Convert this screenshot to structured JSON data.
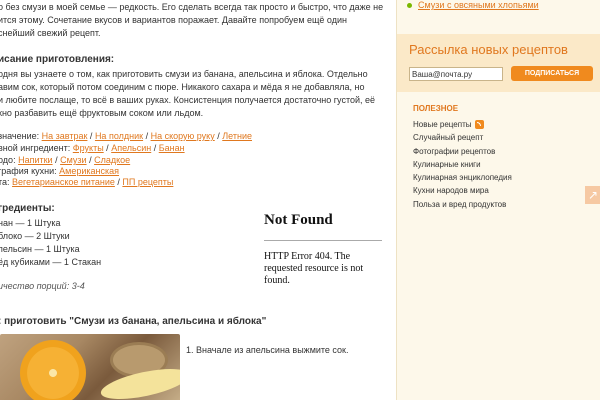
{
  "intro": {
    "line1": "о без смузи в моей семье — редкость. Его сделать всегда так просто и быстро, что даже не",
    "line2": "ится этому. Сочетание вкусов и вариантов поражает. Давайте попробуем ещё один",
    "line3": "снейший свежий рецепт."
  },
  "description": {
    "heading": "исание приготовления:",
    "line1": "одня вы узнаете о том, как приготовить смузи из банана, апельсина и яблока. Отдельно",
    "line2": "авим сок, который потом соединим с пюре. Никакого сахара и мёда я не добавляла, но",
    "line3": "и любите послаще, то всё в ваших руках. Консистенция получается достаточно густой, её",
    "line4": "кно разбавить ещё фруктовым соком или льдом."
  },
  "meta": {
    "purpose_label": "значение:",
    "purpose_links": [
      "На завтрак",
      "На полдник",
      "На скорую руку",
      "Летние"
    ],
    "ingredient_label": "вной ингредиент:",
    "ingredient_links": [
      "Фрукты",
      "Апельсин",
      "Банан"
    ],
    "dish_label": "одо:",
    "dish_links": [
      "Напитки",
      "Смузи",
      "Сладкое"
    ],
    "geo_label": "графия кухни:",
    "geo_links": [
      "Американская"
    ],
    "diet_label": "та:",
    "diet_links": [
      "Вегетарианское питание",
      "ПП рецепты"
    ],
    "separator": " / "
  },
  "ingredients": {
    "heading": "гредиенты:",
    "items": [
      "нан — 1 Штука",
      "блоко — 2 Штуки",
      "пельсин — 1 Штука",
      "ёд кубиками — 1 Стакан"
    ],
    "servings": "ичество порций: 3-4"
  },
  "howto": {
    "heading": ": приготовить \"Смузи из банана, апельсина и яблока\"",
    "step1": "1. Вначале из апельсина выжмите сок."
  },
  "error": {
    "title": "Not Found",
    "message": "HTTP Error 404. The requested resource is not found."
  },
  "sidebar": {
    "prev_link": "Смузи с овсяными хлопьями",
    "newsletter_title": "Рассылка новых рецептов",
    "email_value": "Ваша@почта.ру",
    "subscribe_label": "ПОДПИСАТЬСЯ",
    "useful_heading": "ПОЛЕЗНОЕ",
    "links": [
      "Новые рецепты",
      "Случайный рецепт",
      "Фотографии рецептов",
      "Кулинарные книги",
      "Кулинарная энциклопедия",
      "Кухни народов мира",
      "Польза и вред продуктов"
    ],
    "arrow_glyph": "↗",
    "colors": {
      "accent": "#e0781f",
      "button": "#f08a1e",
      "panel": "#fdf8ea"
    }
  }
}
